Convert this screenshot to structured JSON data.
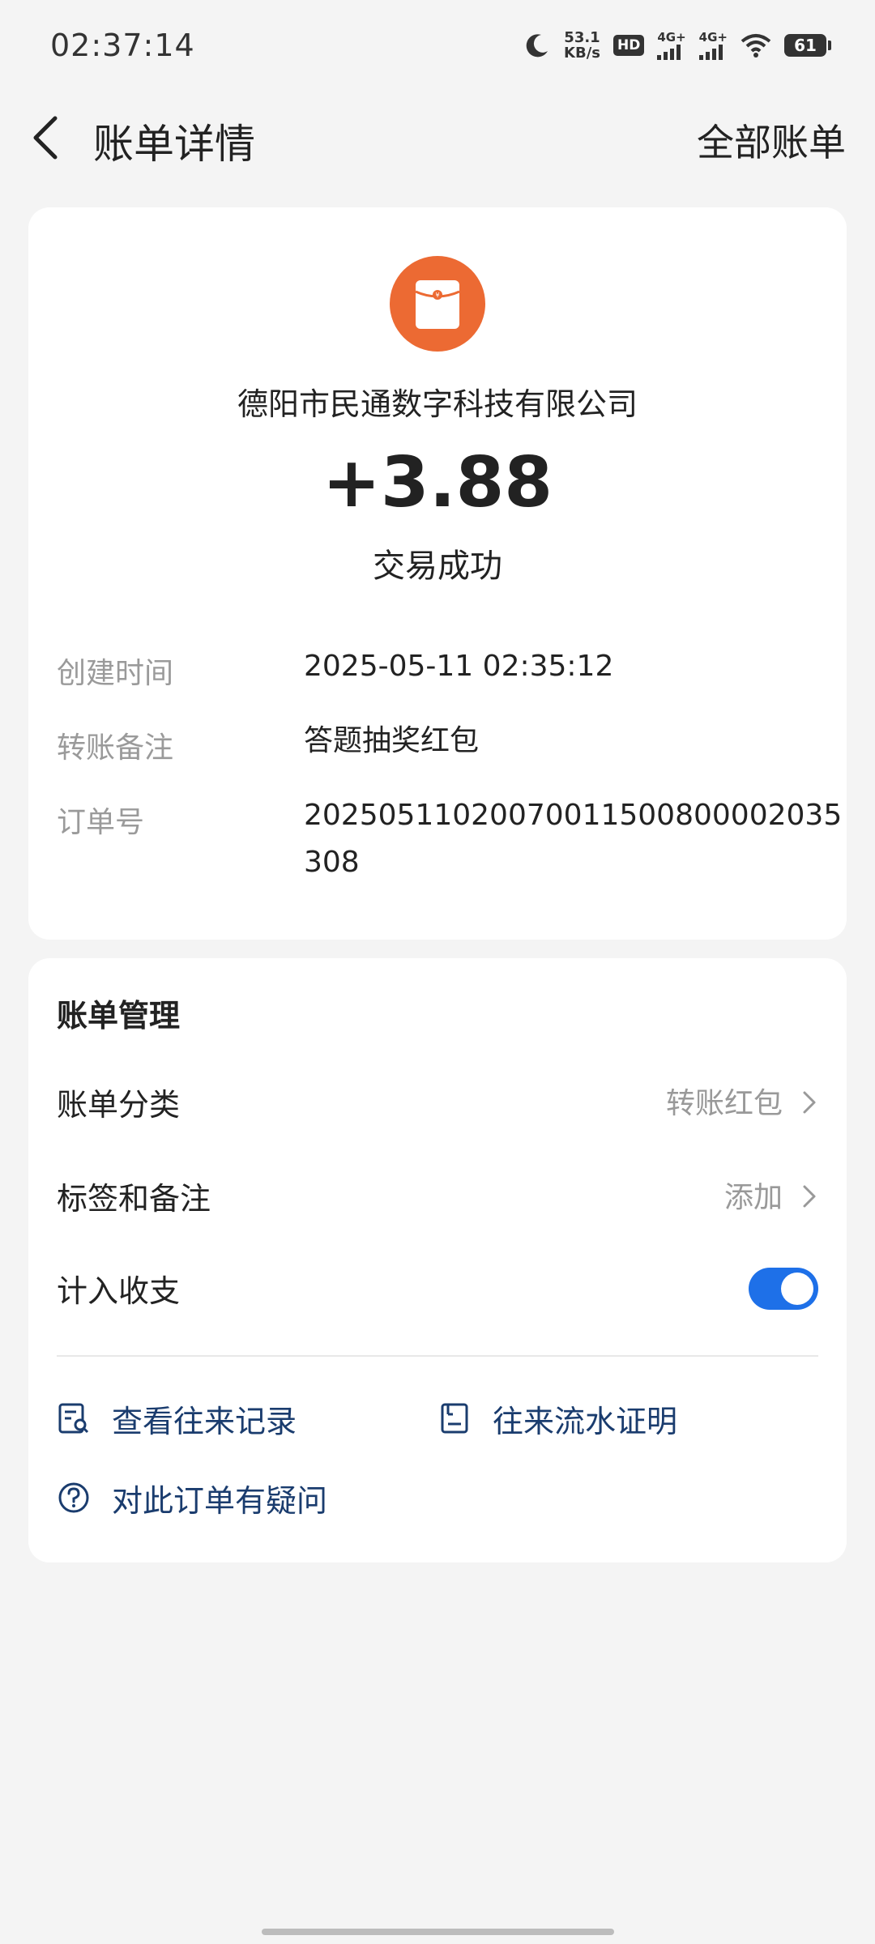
{
  "status_bar": {
    "time": "02:37:14",
    "net_speed_value": "53.1",
    "net_speed_unit": "KB/s",
    "hd_label": "HD",
    "sim1_label": "4G+",
    "sim2_label": "4G+",
    "battery": "61",
    "icons": [
      "moon-icon",
      "hd-icon",
      "signal-icon",
      "signal-icon",
      "wifi-icon",
      "battery-icon"
    ]
  },
  "header": {
    "title": "账单详情",
    "right_action": "全部账单"
  },
  "detail": {
    "merchant_name": "德阳市民通数字科技有限公司",
    "amount": "+3.88",
    "status": "交易成功",
    "rows": [
      {
        "label": "创建时间",
        "value": "2025-05-11 02:35:12"
      },
      {
        "label": "转账备注",
        "value": "答题抽奖红包"
      },
      {
        "label": "订单号",
        "value": "20250511020070011500800002035308"
      }
    ],
    "logo_color": "#ec6a33"
  },
  "manage": {
    "title": "账单管理",
    "category_label": "账单分类",
    "category_value": "转账红包",
    "tags_label": "标签和备注",
    "tags_value": "添加",
    "count_label": "计入收支",
    "count_enabled": true,
    "toggle_color": "#1e70e8",
    "links": {
      "history": "查看往来记录",
      "proof": "往来流水证明",
      "question": "对此订单有疑问"
    },
    "link_color": "#1a3c6e"
  }
}
